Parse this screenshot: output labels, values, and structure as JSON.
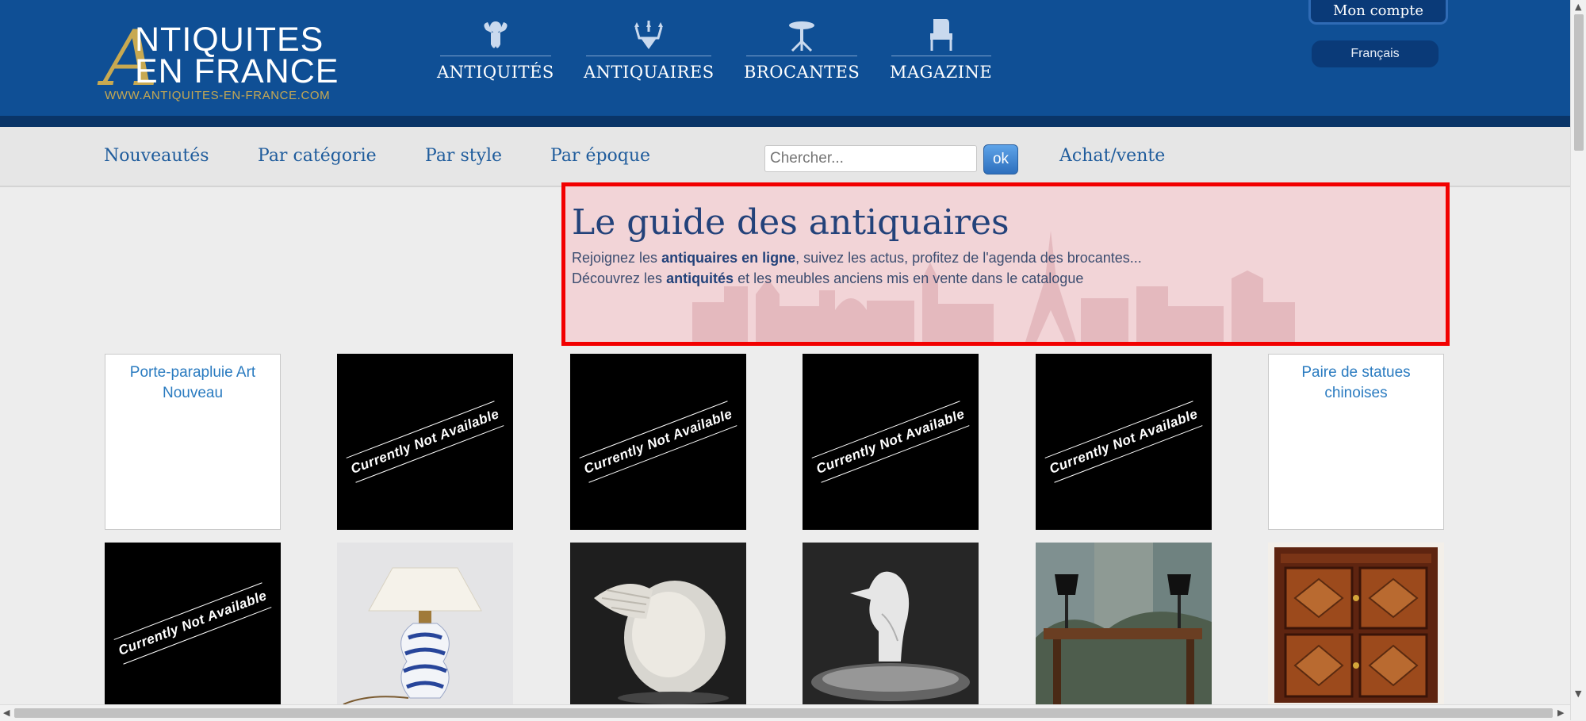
{
  "header": {
    "logo": {
      "letter": "A",
      "line1": "NTIQUITES",
      "line2": "EN FRANCE",
      "url": "WWW.ANTIQUITES-EN-FRANCE.COM"
    },
    "nav": [
      {
        "label": "ANTIQUITÉS",
        "icon": "cherub-icon"
      },
      {
        "label": "ANTIQUAIRES",
        "icon": "chandelier-icon"
      },
      {
        "label": "BROCANTES",
        "icon": "pedestal-table-icon"
      },
      {
        "label": "MAGAZINE",
        "icon": "armchair-icon"
      }
    ],
    "account_label": "Mon compte",
    "language": "Français"
  },
  "subnav": {
    "links": [
      "Nouveautés",
      "Par catégorie",
      "Par style",
      "Par époque"
    ],
    "search_placeholder": "Chercher...",
    "search_button": "ok",
    "buy_sell": "Achat/vente"
  },
  "guide": {
    "title": "Le guide des antiquaires",
    "line1_pre": "Rejoignez les ",
    "line1_bold": "antiquaires en ligne",
    "line1_post": ", suivez les actus, profitez de l'agenda des brocantes...",
    "line2_pre": "Découvrez les ",
    "line2_bold": "antiquités",
    "line2_post": " et les meubles anciens mis en vente dans le catalogue"
  },
  "products_row1": [
    {
      "type": "alt",
      "alt": "Porte-parapluie Art Nouveau"
    },
    {
      "type": "unavailable",
      "text": "Currently Not Available"
    },
    {
      "type": "unavailable",
      "text": "Currently Not Available"
    },
    {
      "type": "unavailable",
      "text": "Currently Not Available"
    },
    {
      "type": "unavailable",
      "text": "Currently Not Available"
    },
    {
      "type": "alt",
      "alt": "Paire de statues chinoises"
    }
  ],
  "products_row2": [
    {
      "type": "unavailable",
      "text": "Currently Not Available"
    },
    {
      "type": "photo",
      "subject": "blue-white-porcelain-lamp"
    },
    {
      "type": "photo",
      "subject": "glass-bird-sculpture"
    },
    {
      "type": "photo",
      "subject": "glass-dove-ring-dish"
    },
    {
      "type": "photo",
      "subject": "table-with-lamps-and-screen"
    },
    {
      "type": "photo",
      "subject": "marquetry-cabinet"
    }
  ],
  "colors": {
    "header": "#0f4f95",
    "gold": "#c8a951",
    "link": "#1f5c9c",
    "highlight": "#f20000"
  }
}
